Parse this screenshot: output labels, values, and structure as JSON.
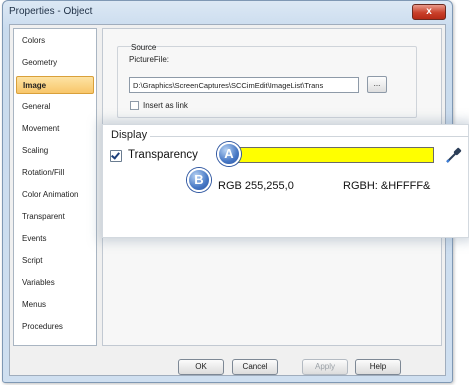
{
  "window": {
    "title": "Properties - Object",
    "close_glyph": "x"
  },
  "sidebar": {
    "items": [
      {
        "label": "Colors"
      },
      {
        "label": "Geometry"
      },
      {
        "label": "Image",
        "selected": true
      },
      {
        "label": "General"
      },
      {
        "label": "Movement"
      },
      {
        "label": "Scaling"
      },
      {
        "label": "Rotation/Fill"
      },
      {
        "label": "Color Animation"
      },
      {
        "label": "Transparent"
      },
      {
        "label": "Events"
      },
      {
        "label": "Script"
      },
      {
        "label": "Variables"
      },
      {
        "label": "Menus"
      },
      {
        "label": "Procedures"
      }
    ]
  },
  "source": {
    "group_label": "Source",
    "picturefile_label": "PictureFile:",
    "picturefile_value": "D:\\Graphics\\ScreenCaptures\\SCCimEdit\\ImageList\\Trans",
    "browse_label": "...",
    "insert_as_link_label": "Insert as link",
    "insert_as_link_checked": false
  },
  "display": {
    "group_label": "Display",
    "transparency_label": "Transparency",
    "transparency_checked": true,
    "transparency_color": "#ffff00",
    "rgb_text": "RGB 255,255,0",
    "rgbh_text": "RGBH: &HFFFF&",
    "marker_a": "A",
    "marker_b": "B",
    "eyedropper_icon": "eyedropper-icon"
  },
  "buttons": {
    "ok": "OK",
    "cancel": "Cancel",
    "apply": "Apply",
    "help": "Help"
  },
  "colors": {
    "selected_item": "#f8c66a",
    "marker": "#4677c4"
  }
}
